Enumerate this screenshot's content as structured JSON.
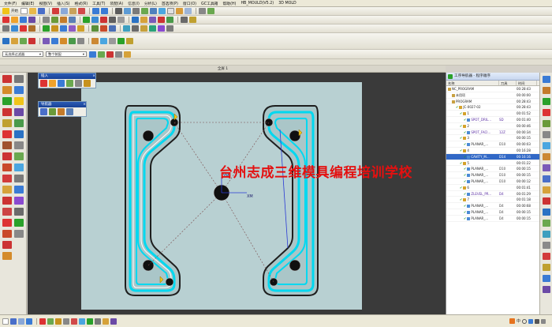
{
  "menubar": {
    "items": [
      "文件(F)",
      "编辑(E)",
      "视图(V)",
      "插入(S)",
      "格式(R)",
      "工具(T)",
      "装配(A)",
      "信息(I)",
      "分析(L)",
      "首选项(P)",
      "窗口(O)",
      "GC工具箱",
      "帮助(H)",
      "HB_MOULD(V5.2)",
      "3D MOLD"
    ]
  },
  "toolbar1": {
    "start_label": "开始"
  },
  "toolbar4": {
    "filter_value": "无选择过滤器",
    "assembly_value": "整个装配"
  },
  "viewport": {
    "title": "全屏 1",
    "watermark": "台州志成三维模具编程培训学校",
    "wcs_x": "XM",
    "wcs_y": "YM"
  },
  "panels": {
    "insert": {
      "title": "插入"
    },
    "navigator": {
      "title": "导航器"
    }
  },
  "operation_navigator": {
    "title": "工序导航器 - 程序顺序",
    "columns": {
      "name": "名称",
      "tool": "刀具",
      "time": "时间"
    },
    "rows": [
      {
        "name": "NC_PROGRAM",
        "tool": "",
        "time": "00:28:43"
      },
      {
        "name": "未用项",
        "tool": "",
        "time": "00:00:00"
      },
      {
        "name": "PROGRAM",
        "tool": "",
        "time": "00:28:43"
      },
      {
        "name": "JC-0027-02",
        "tool": "",
        "time": "00:28:43"
      },
      {
        "name": "1",
        "tool": "",
        "time": "00:01:52"
      },
      {
        "name": "SPOT_DRIL...",
        "tool": "SD",
        "time": "00:01:40"
      },
      {
        "name": "2",
        "tool": "",
        "time": "00:00:46"
      },
      {
        "name": "SPOT_FACI...",
        "tool": "12Z",
        "time": "00:00:34"
      },
      {
        "name": "3",
        "tool": "",
        "time": "00:00:15"
      },
      {
        "name": "PLANAR_...",
        "tool": "D10",
        "time": "00:00:03"
      },
      {
        "name": "4",
        "tool": "",
        "time": "00:16:28"
      },
      {
        "name": "CAVITY_M...",
        "tool": "D14",
        "time": "00:16:16"
      },
      {
        "name": "5",
        "tool": "",
        "time": "00:01:22"
      },
      {
        "name": "PLANAR_...",
        "tool": "D10",
        "time": "00:00:15"
      },
      {
        "name": "PLANAR_...",
        "tool": "D10",
        "time": "00:00:15"
      },
      {
        "name": "PLANAR_...",
        "tool": "D10",
        "time": "00:00:12"
      },
      {
        "name": "6",
        "tool": "",
        "time": "00:01:41"
      },
      {
        "name": "ZLEVEL_PR...",
        "tool": "D4",
        "time": "00:01:29"
      },
      {
        "name": "7",
        "tool": "",
        "time": "00:01:18"
      },
      {
        "name": "PLANAR_...",
        "tool": "D4",
        "time": "00:00:68"
      },
      {
        "name": "PLANAR_...",
        "tool": "D4",
        "time": "00:00:15"
      },
      {
        "name": "PLANAR_...",
        "tool": "D4",
        "time": "00:00:15"
      }
    ]
  },
  "ime": {
    "lang": "中"
  },
  "colors": {
    "viewport_bg": "#3a3a3a",
    "part_bg": "#b8d0d2",
    "toolpath": "#00d8f0",
    "highlight": "#3168c6",
    "watermark": "#e41010"
  }
}
